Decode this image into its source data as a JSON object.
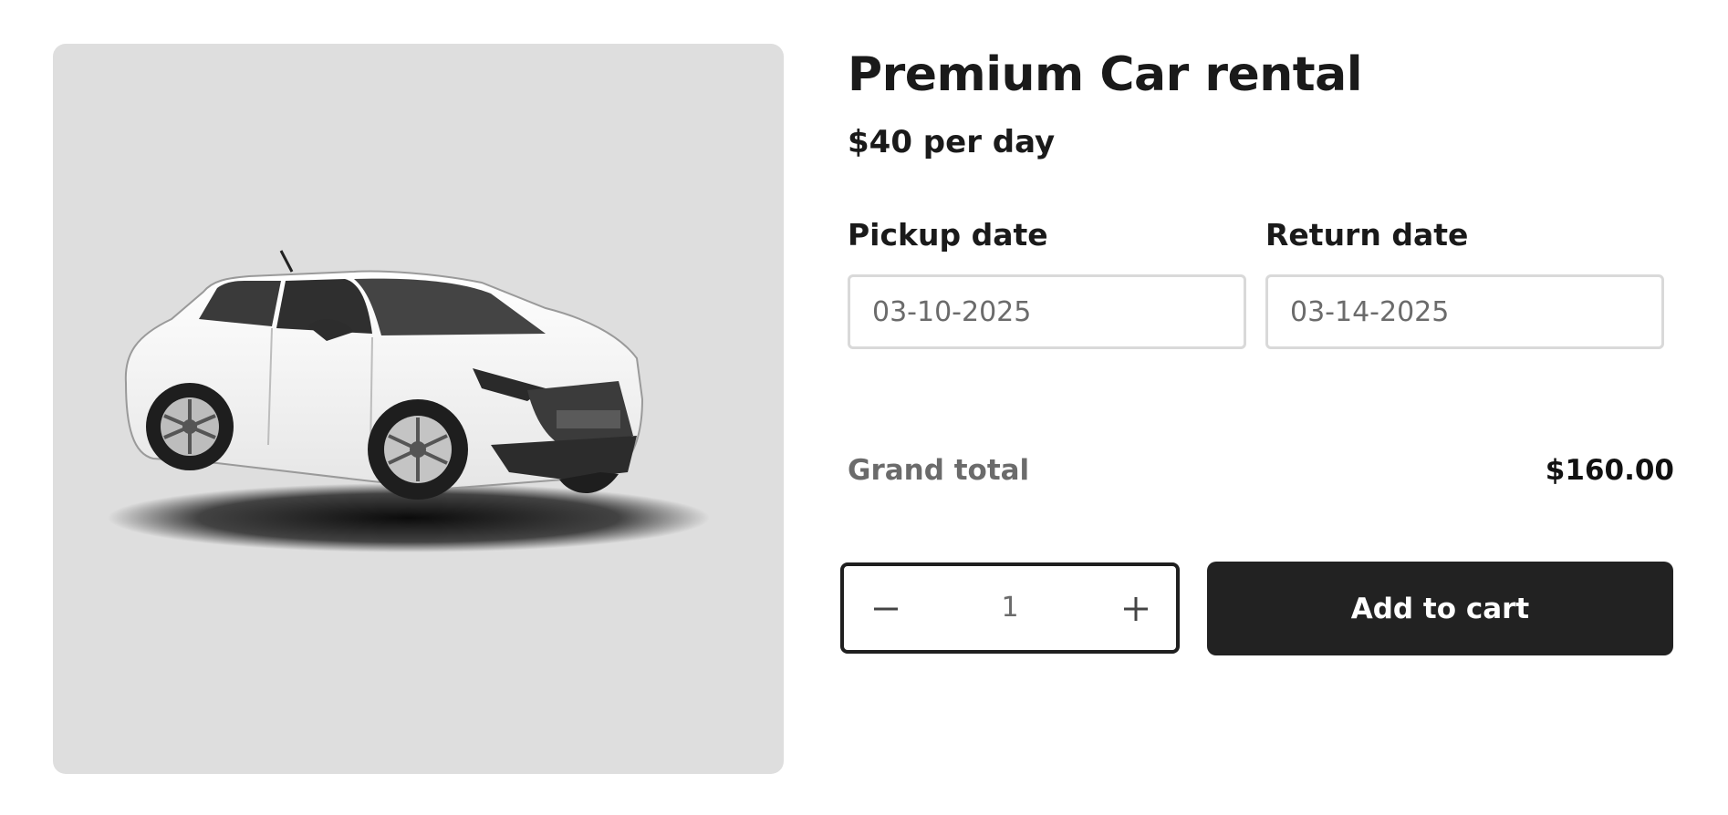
{
  "product": {
    "title": "Premium Car rental",
    "price": "$40 per day",
    "image_icon": "car-photo"
  },
  "booking": {
    "pickup_label": "Pickup date",
    "pickup_value": "03-10-2025",
    "return_label": "Return date",
    "return_value": "03-14-2025"
  },
  "summary": {
    "grand_total_label": "Grand total",
    "grand_total_value": "$160.00"
  },
  "quantity": {
    "value": "1",
    "minus_icon": "minus-icon",
    "plus_icon": "plus-icon"
  },
  "actions": {
    "add_to_cart_label": "Add to cart"
  },
  "colors": {
    "image_background": "#dedede",
    "button_background": "#222222",
    "button_text": "#ffffff",
    "muted_text": "#6b6b6b",
    "input_border": "#d9d9d9"
  }
}
